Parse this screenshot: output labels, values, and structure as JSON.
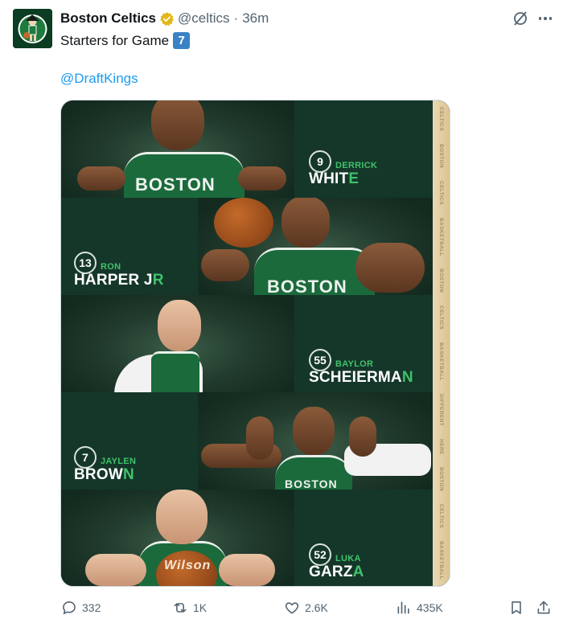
{
  "author": {
    "name": "Boston Celtics",
    "handle": "@celtics",
    "separator": "·",
    "time": "36m"
  },
  "tweet": {
    "text": "Starters for Game",
    "number_emoji": "7",
    "mention": "@DraftKings"
  },
  "graphic": {
    "strip_words": [
      "CELTICS",
      "BOSTON",
      "CELTICS",
      "BASKETBALL",
      "BOSTON",
      "CELTICS",
      "BASKETBALL",
      "DIFFERENT",
      "HERE",
      "BOSTON",
      "CELTICS",
      "BASKETBALL"
    ],
    "players": [
      {
        "number": "9",
        "first": "DERRICK",
        "last_main": "WHIT",
        "last_accent": "E",
        "jersey": "BOSTON"
      },
      {
        "number": "13",
        "first": "RON",
        "last_main": "HARPER J",
        "last_accent": "R",
        "jersey": "BOSTON"
      },
      {
        "number": "55",
        "first": "BAYLOR",
        "last_main": "SCHEIERMA",
        "last_accent": "N",
        "jersey": ""
      },
      {
        "number": "7",
        "first": "JAYLEN",
        "last_main": "BROW",
        "last_accent": "N",
        "jersey": "BOSTON"
      },
      {
        "number": "52",
        "first": "LUKA",
        "last_main": "GARZ",
        "last_accent": "A",
        "jersey": "Wilson"
      }
    ]
  },
  "actions": {
    "replies": "332",
    "reposts": "1K",
    "likes": "2.6K",
    "views": "435K"
  },
  "colors": {
    "link": "#1d9bf0",
    "celtics_green": "#1b6a3c",
    "accent_green": "#3fc26a",
    "muted": "#536471"
  }
}
